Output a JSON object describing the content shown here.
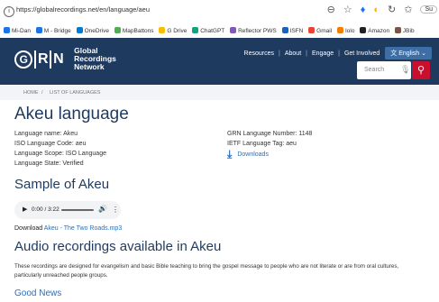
{
  "browser": {
    "url": "https://globalrecordings.net/en/language/aeu",
    "sync_label": "Su",
    "bookmarks": [
      {
        "label": "Mi-Dan",
        "color": "#1a73e8"
      },
      {
        "label": "M - Bridge",
        "color": "#1a73e8"
      },
      {
        "label": "OneDrive",
        "color": "#0078d4"
      },
      {
        "label": "MapBattons",
        "color": "#4caf50"
      },
      {
        "label": "G Drive",
        "color": "#fbbc04"
      },
      {
        "label": "ChatGPT",
        "color": "#10a37f"
      },
      {
        "label": "Reflector PWS",
        "color": "#7e57c2"
      },
      {
        "label": "ISFN",
        "color": "#1565c0"
      },
      {
        "label": "Gmail",
        "color": "#ea4335"
      },
      {
        "label": "Iolo",
        "color": "#f57c00"
      },
      {
        "label": "Amazon",
        "color": "#222222"
      },
      {
        "label": "JBib",
        "color": "#795548"
      }
    ]
  },
  "header": {
    "logo_letters": {
      "g": "G",
      "r": "R",
      "n": "N"
    },
    "logo_lines": [
      "Global",
      "Recordings",
      "Network"
    ],
    "nav": [
      "Resources",
      "About",
      "Engage",
      "Get Involved"
    ],
    "lang_button": "English",
    "search_placeholder": "Search"
  },
  "breadcrumb": [
    "HOME",
    "LIST OF LANGUAGES"
  ],
  "page": {
    "title": "Akeu language",
    "details_left": [
      "Language name: Akeu",
      "ISO Language Code: aeu",
      "Language Scope: ISO Language",
      "Language State: Verified"
    ],
    "details_right": [
      "GRN Language Number: 1148",
      "IETF Language Tag: aeu"
    ],
    "downloads_label": "Downloads",
    "sample_heading": "Sample of Akeu",
    "player": {
      "time": "0:00 / 3:22"
    },
    "download_prefix": "Download",
    "download_link": "Akeu - The Two Roads.mp3",
    "audio_heading": "Audio recordings available in Akeu",
    "description": "These recordings are designed for evangelism and basic Bible teaching to bring the gospel message to people who are not literate or are from oral cultures, particularly unreached people groups.",
    "good_news": "Good News"
  }
}
